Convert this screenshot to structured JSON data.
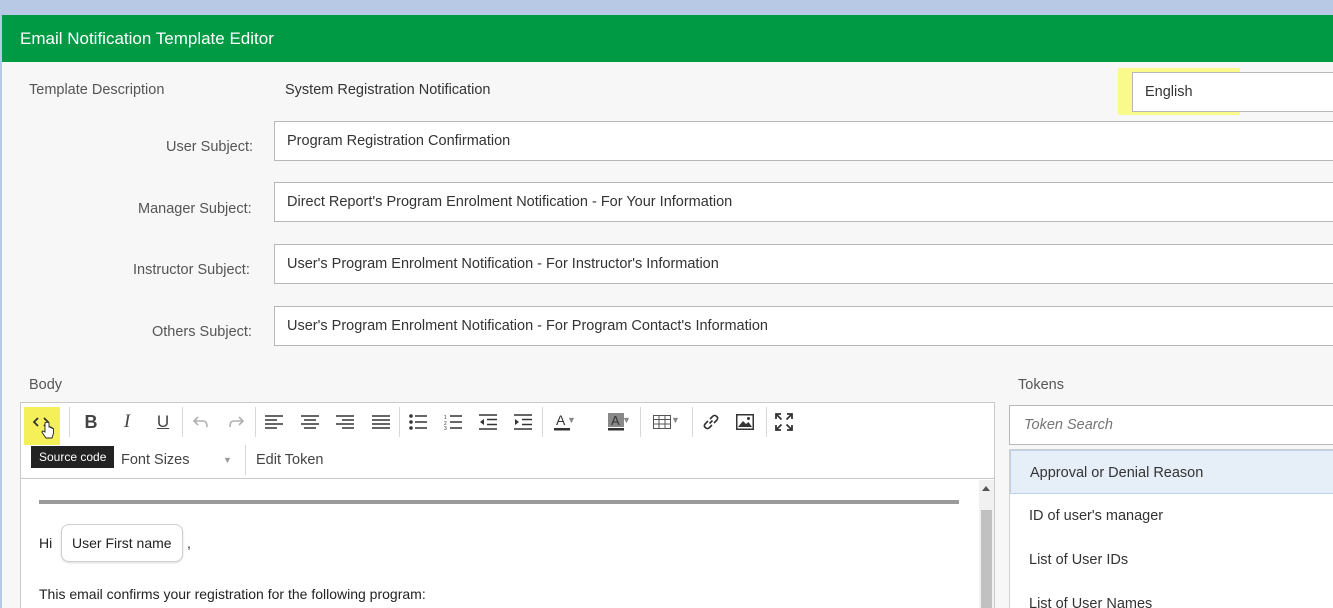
{
  "window": {
    "title": "Email Notification Template Editor"
  },
  "template": {
    "description_label": "Template Description",
    "description_value": "System Registration Notification",
    "language": "English"
  },
  "subjects": {
    "user_label": "User Subject:",
    "user_value": "Program Registration Confirmation",
    "manager_label": "Manager Subject:",
    "manager_value": "Direct Report's Program Enrolment Notification - For Your Information",
    "instructor_label": "Instructor Subject:",
    "instructor_value": "User's Program Enrolment Notification - For Instructor's Information",
    "others_label": "Others Subject:",
    "others_value": "User's Program Enrolment Notification - For Program Contact's Information"
  },
  "body": {
    "label": "Body",
    "tooltip": "Source code",
    "font_sizes_label": "Font Sizes",
    "edit_token_label": "Edit Token",
    "greeting": "Hi",
    "token_chip": "User First name",
    "after_chip": ",",
    "line2": "This email confirms your registration for the following program:"
  },
  "tokens": {
    "label": "Tokens",
    "search_placeholder": "Token Search",
    "items": [
      {
        "label": "Approval or Denial Reason",
        "selected": true
      },
      {
        "label": "ID of user's manager",
        "selected": false
      },
      {
        "label": "List of User IDs",
        "selected": false
      },
      {
        "label": "List of User Names",
        "selected": false
      }
    ]
  },
  "colors": {
    "header_green": "#009a44",
    "highlight_yellow": "#fafa8c",
    "selected_row": "#e6eef8"
  },
  "icons": [
    "source-code-icon",
    "bold-icon",
    "italic-icon",
    "underline-icon",
    "undo-icon",
    "redo-icon",
    "align-left-icon",
    "align-center-icon",
    "align-right-icon",
    "align-justify-icon",
    "bullet-list-icon",
    "numbered-list-icon",
    "outdent-icon",
    "indent-icon",
    "text-color-icon",
    "background-color-icon",
    "table-icon",
    "link-icon",
    "image-icon",
    "fullscreen-icon"
  ]
}
